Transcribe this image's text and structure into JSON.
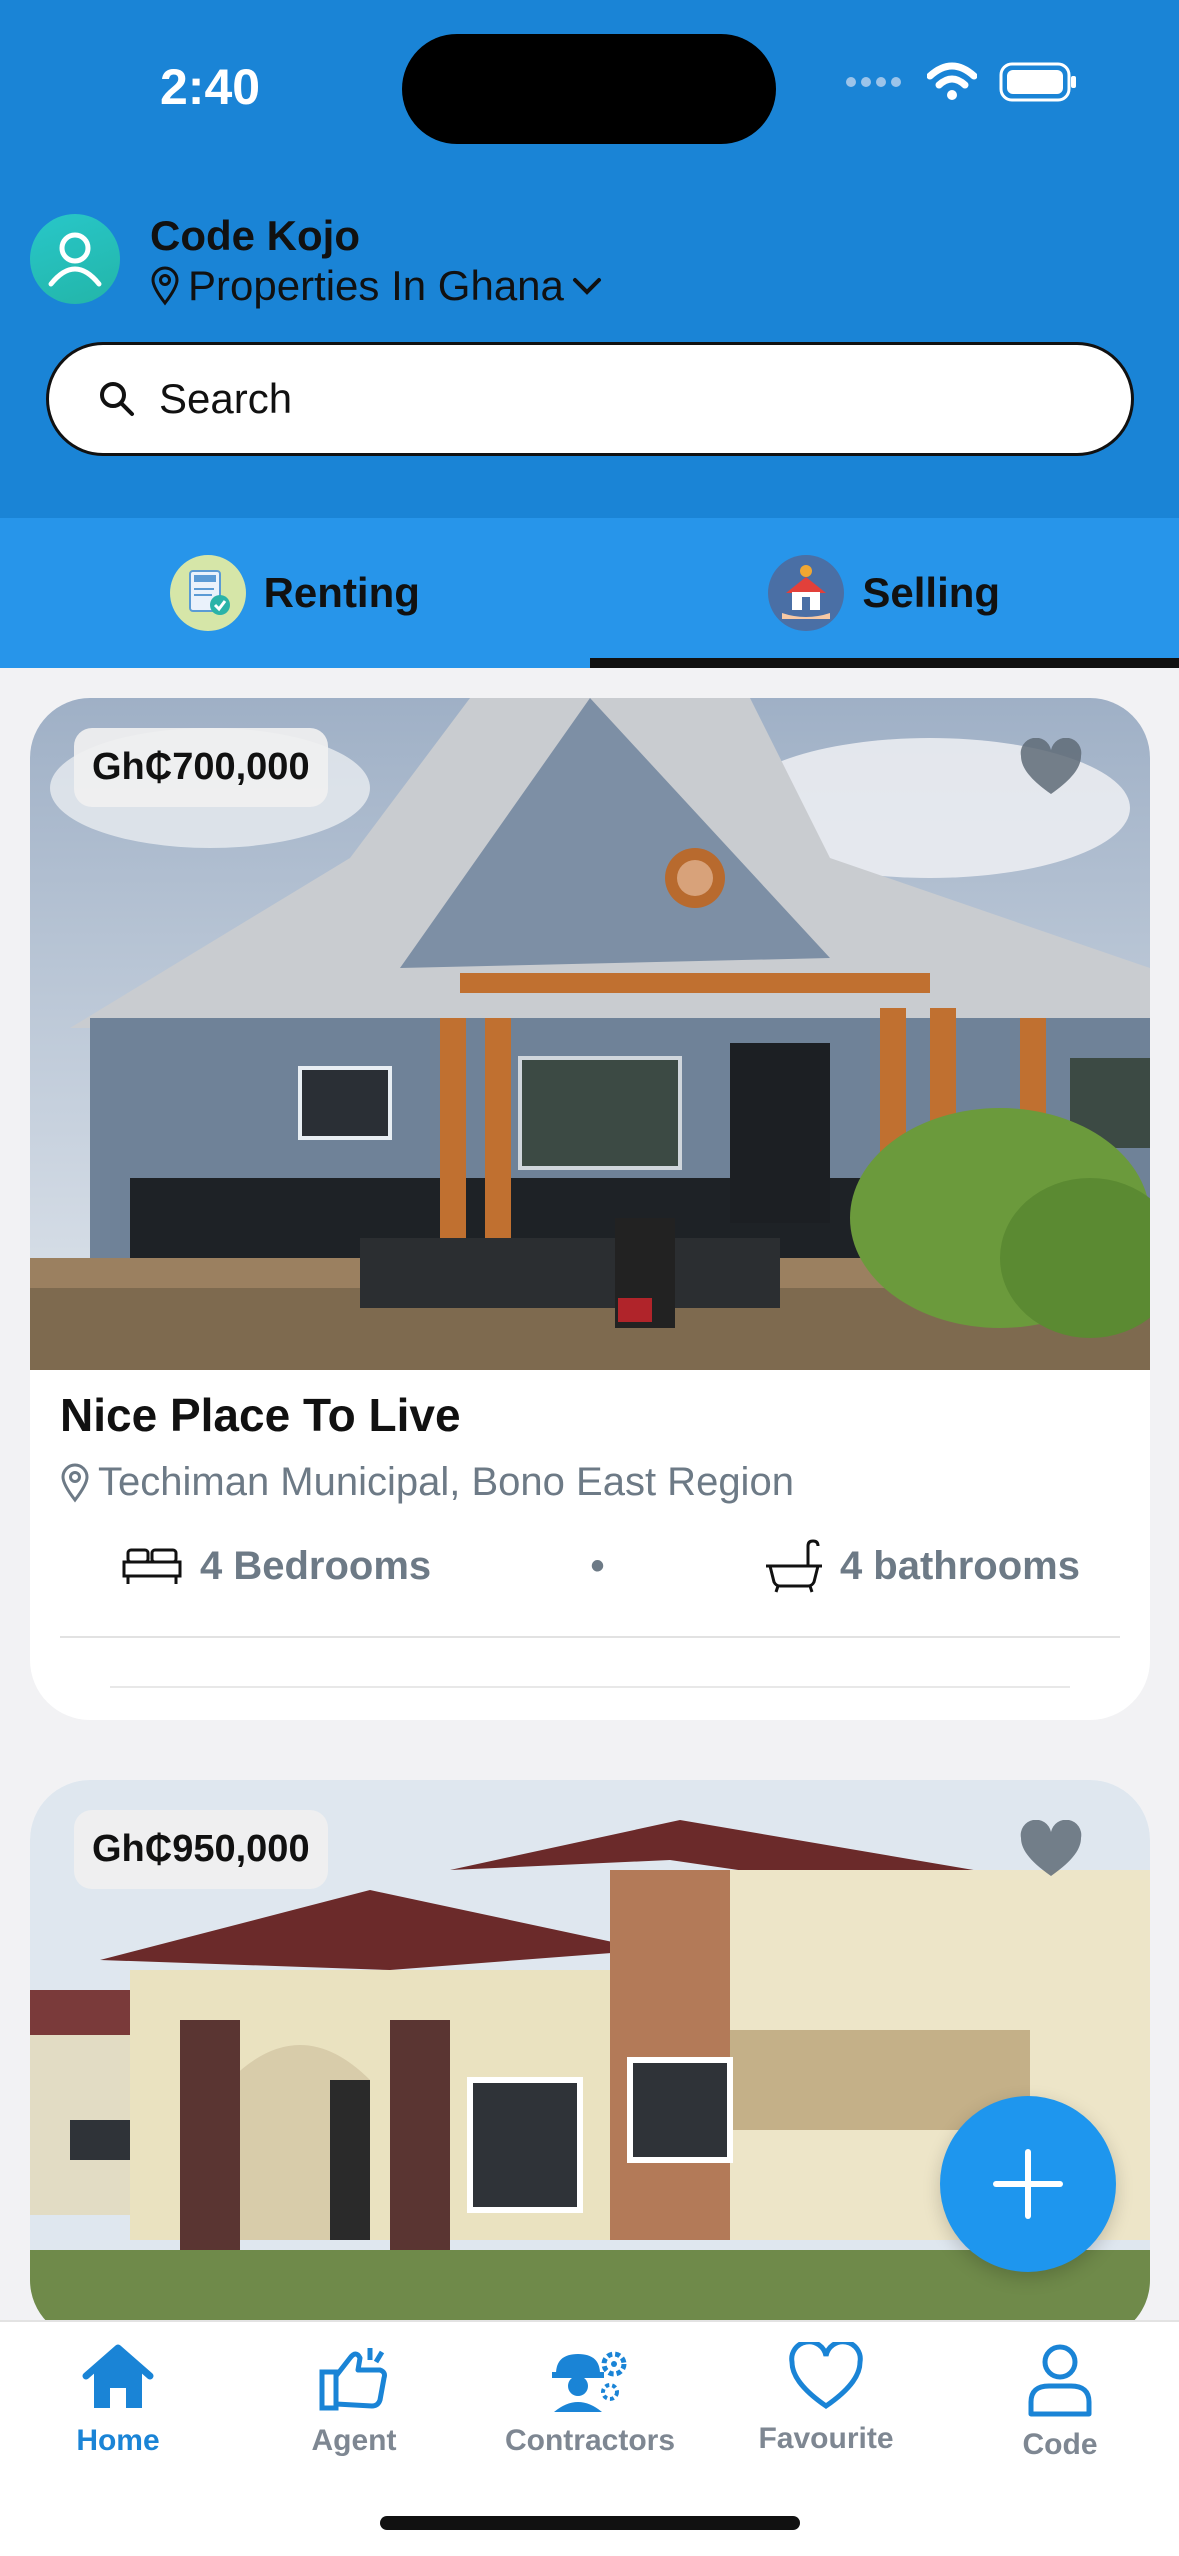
{
  "status_bar": {
    "time": "2:40"
  },
  "profile": {
    "name": "Code Kojo",
    "location": "Properties In Ghana"
  },
  "search": {
    "label": "Search"
  },
  "tabs": [
    {
      "label": "Renting",
      "active": false
    },
    {
      "label": "Selling",
      "active": true
    }
  ],
  "listings": [
    {
      "price": "Gh₵700,000",
      "title": "Nice Place To Live",
      "location": "Techiman Municipal, Bono East Region",
      "bedrooms": "4 Bedrooms",
      "bathrooms": "4 bathrooms"
    },
    {
      "price": "Gh₵950,000"
    }
  ],
  "bottom_nav": [
    {
      "label": "Home",
      "icon": "home-icon",
      "active": true
    },
    {
      "label": "Agent",
      "icon": "agent-icon",
      "active": false
    },
    {
      "label": "Contractors",
      "icon": "contractors-icon",
      "active": false
    },
    {
      "label": "Favourite",
      "icon": "heart-icon",
      "active": false
    },
    {
      "label": "Code",
      "icon": "person-icon",
      "active": false
    }
  ],
  "colors": {
    "primary": "#1a84d6",
    "tab_bar": "#2795ea",
    "fab": "#1e96ee",
    "muted": "#6d7a86"
  }
}
